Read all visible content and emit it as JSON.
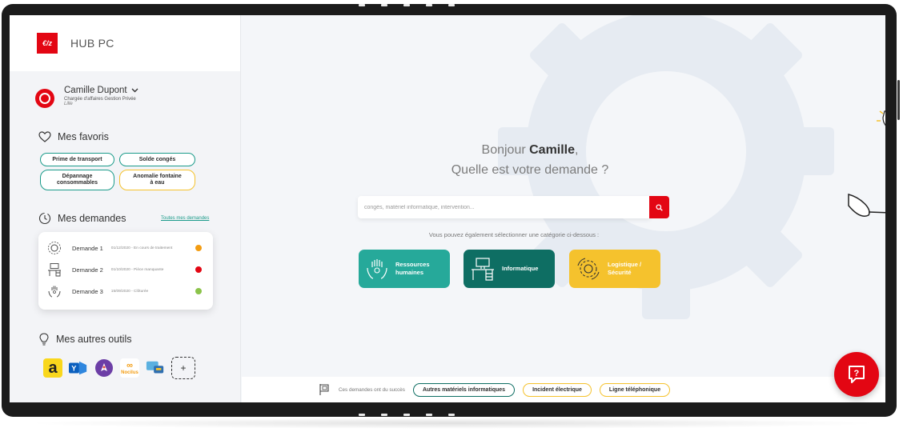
{
  "app": {
    "logo_text": "€/z",
    "title": "HUB PC"
  },
  "user": {
    "name": "Camille Dupont",
    "role": "Chargée d'affaires Gestion Privée",
    "city": "Lille"
  },
  "favoris": {
    "title": "Mes favoris",
    "items": [
      {
        "label": "Prime de transport",
        "style": "teal"
      },
      {
        "label": "Solde congés",
        "style": "teal"
      },
      {
        "label": "Dépannage\nconsommables",
        "style": "teal"
      },
      {
        "label": "Anomalie fontaine\nà eau",
        "style": "yellow"
      }
    ]
  },
  "demandes": {
    "title": "Mes demandes",
    "link": "Toutes mes demandes",
    "items": [
      {
        "name": "Demande 1",
        "meta": "01/12/2020 - En cours de traitement",
        "icon": "gear-icon",
        "status_color": "#f39c12"
      },
      {
        "name": "Demande 2",
        "meta": "01/10/2020 - Pièce manquante",
        "icon": "desk-icon",
        "status_color": "#e30613"
      },
      {
        "name": "Demande 3",
        "meta": "15/09/2020 - Clôturée",
        "icon": "hands-icon",
        "status_color": "#8bc34a"
      }
    ]
  },
  "outils": {
    "title": "Mes autres outils",
    "items": [
      {
        "icon": "amazon-icon",
        "label": "a"
      },
      {
        "icon": "yammer-icon",
        "label": "Y"
      },
      {
        "icon": "rocket-icon",
        "label": ""
      },
      {
        "icon": "nocilus-icon",
        "label": "Nocilus"
      },
      {
        "icon": "chat-app-icon",
        "label": ""
      }
    ],
    "add_label": "+"
  },
  "main": {
    "greeting_prefix": "Bonjour ",
    "greeting_name": "Camille",
    "greeting_suffix": ",",
    "question": "Quelle est votre demande ?",
    "search_placeholder": "congés, matériel informatique, intervention...",
    "subtitle": "Vous pouvez également sélectionner une catégorie ci-dessous :",
    "categories": [
      {
        "label_1": "Ressources",
        "label_2": "humaines",
        "color": "#26a99a"
      },
      {
        "label_1": "Informatique",
        "label_2": "",
        "color": "#0e6e63"
      },
      {
        "label_1": "Logistique /",
        "label_2": "Sécurité",
        "color": "#f5c22d"
      }
    ]
  },
  "footer": {
    "label": "Ces demandes ont du succès",
    "pills": [
      {
        "label": "Autres matériels informatiques",
        "style": "teal"
      },
      {
        "label": "Incident électrique",
        "style": "yellow"
      },
      {
        "label": "Ligne téléphonique",
        "style": "yellow"
      }
    ]
  },
  "help": {
    "label": "?"
  },
  "colors": {
    "brand_red": "#e30613",
    "teal": "#26a99a",
    "dark_teal": "#0e6e63",
    "yellow": "#f5c22d"
  }
}
